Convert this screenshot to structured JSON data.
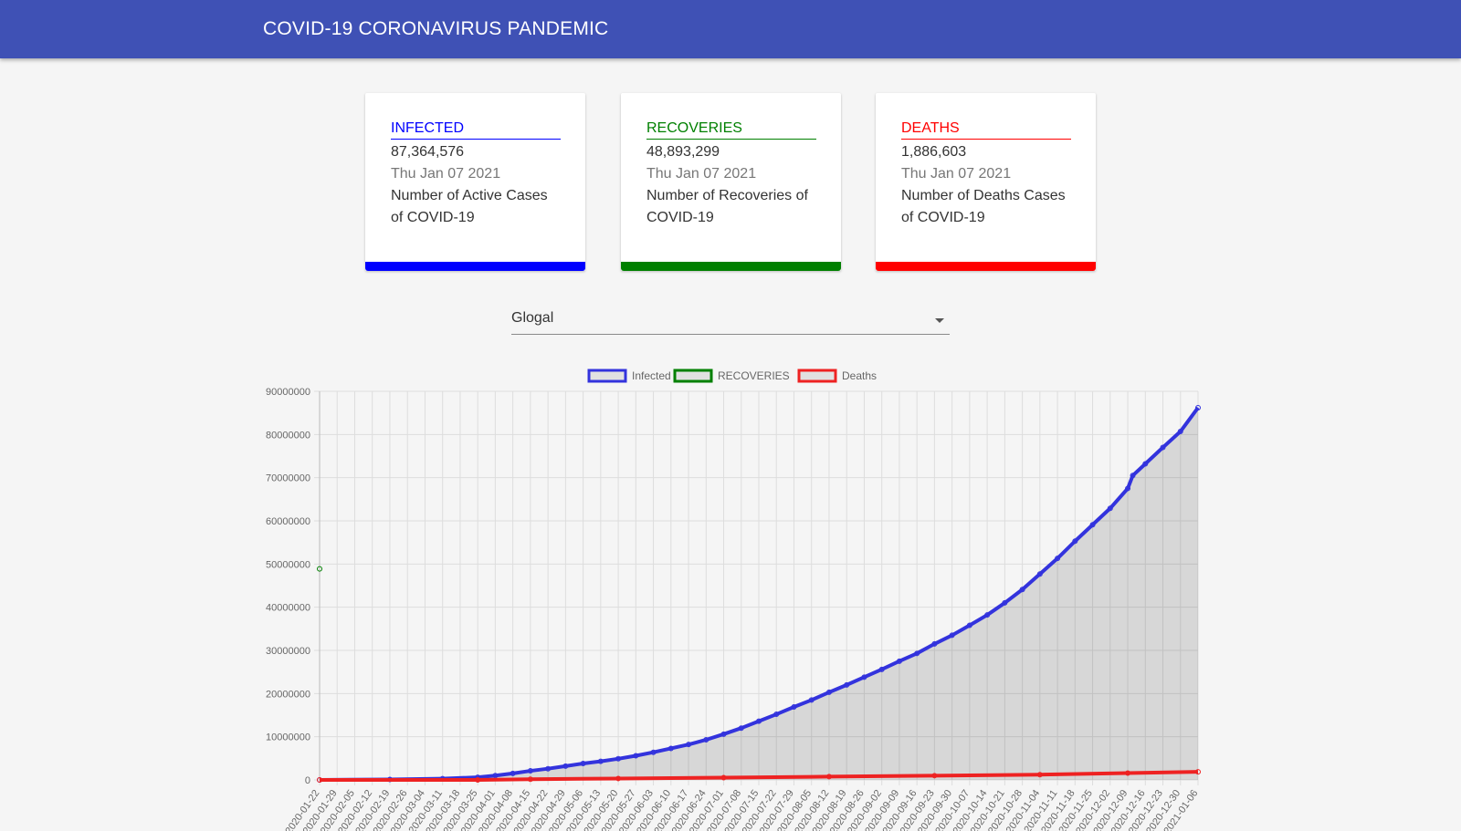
{
  "header": {
    "title": "COVID-19 CORONAVIRUS PANDEMIC"
  },
  "cards": [
    {
      "key": "infected",
      "title": "INFECTED",
      "value": "87,364,576",
      "date": "Thu Jan 07 2021",
      "description": "Number of Active Cases of COVID-19",
      "color": "#0000ff"
    },
    {
      "key": "recoveries",
      "title": "RECOVERIES",
      "value": "48,893,299",
      "date": "Thu Jan 07 2021",
      "description": "Number of Recoveries of COVID-19",
      "color": "#008000"
    },
    {
      "key": "deaths",
      "title": "DEATHS",
      "value": "1,886,603",
      "date": "Thu Jan 07 2021",
      "description": "Number of Deaths Cases of COVID-19",
      "color": "#ff0000"
    }
  ],
  "country_select": {
    "selected": "Glogal"
  },
  "chart_data": {
    "type": "line",
    "legend": [
      "Infected",
      "RECOVERIES",
      "Deaths"
    ],
    "legend_position": "top",
    "grid": true,
    "ylim": [
      0,
      90000000
    ],
    "y_ticks": [
      "0",
      "10000000",
      "20000000",
      "30000000",
      "40000000",
      "50000000",
      "60000000",
      "70000000",
      "80000000",
      "90000000"
    ],
    "x_start": "2020-01-22",
    "x_end": "2021-01-06",
    "x_ticks": [
      "2020-01-22",
      "2020-01-29",
      "2020-02-05",
      "2020-02-12",
      "2020-02-19",
      "2020-02-26",
      "2020-03-04",
      "2020-03-11",
      "2020-03-18",
      "2020-03-25",
      "2020-04-01",
      "2020-04-08",
      "2020-04-15",
      "2020-04-22",
      "2020-04-29",
      "2020-05-06",
      "2020-05-13",
      "2020-05-20",
      "2020-05-27",
      "2020-06-03",
      "2020-06-10",
      "2020-06-17",
      "2020-06-24",
      "2020-07-01",
      "2020-07-08",
      "2020-07-15",
      "2020-07-22",
      "2020-07-29",
      "2020-08-05",
      "2020-08-12",
      "2020-08-19",
      "2020-08-26",
      "2020-09-02",
      "2020-09-09",
      "2020-09-16",
      "2020-09-23",
      "2020-09-30",
      "2020-10-07",
      "2020-10-14",
      "2020-10-21",
      "2020-10-28",
      "2020-11-04",
      "2020-11-11",
      "2020-11-18",
      "2020-11-25",
      "2020-12-02",
      "2020-12-09",
      "2020-12-16",
      "2020-12-23",
      "2020-12-30",
      "2021-01-06"
    ],
    "series": [
      {
        "name": "Infected",
        "color": "#3333dd",
        "fill": true,
        "points": [
          [
            "2020-01-22",
            0
          ],
          [
            "2020-02-19",
            100000
          ],
          [
            "2020-03-11",
            300000
          ],
          [
            "2020-03-25",
            600000
          ],
          [
            "2020-04-01",
            1000000
          ],
          [
            "2020-04-08",
            1500000
          ],
          [
            "2020-04-15",
            2100000
          ],
          [
            "2020-04-22",
            2600000
          ],
          [
            "2020-04-29",
            3200000
          ],
          [
            "2020-05-06",
            3800000
          ],
          [
            "2020-05-13",
            4300000
          ],
          [
            "2020-05-20",
            4900000
          ],
          [
            "2020-05-27",
            5600000
          ],
          [
            "2020-06-03",
            6400000
          ],
          [
            "2020-06-10",
            7300000
          ],
          [
            "2020-06-17",
            8200000
          ],
          [
            "2020-06-24",
            9300000
          ],
          [
            "2020-07-01",
            10600000
          ],
          [
            "2020-07-08",
            12000000
          ],
          [
            "2020-07-15",
            13600000
          ],
          [
            "2020-07-22",
            15200000
          ],
          [
            "2020-07-29",
            16900000
          ],
          [
            "2020-08-05",
            18500000
          ],
          [
            "2020-08-12",
            20300000
          ],
          [
            "2020-08-19",
            22000000
          ],
          [
            "2020-08-26",
            23800000
          ],
          [
            "2020-09-02",
            25600000
          ],
          [
            "2020-09-09",
            27500000
          ],
          [
            "2020-09-16",
            29300000
          ],
          [
            "2020-09-23",
            31500000
          ],
          [
            "2020-09-30",
            33500000
          ],
          [
            "2020-10-07",
            35800000
          ],
          [
            "2020-10-14",
            38200000
          ],
          [
            "2020-10-21",
            41000000
          ],
          [
            "2020-10-28",
            44100000
          ],
          [
            "2020-11-04",
            47700000
          ],
          [
            "2020-11-11",
            51300000
          ],
          [
            "2020-11-18",
            55300000
          ],
          [
            "2020-11-25",
            59100000
          ],
          [
            "2020-12-02",
            62900000
          ],
          [
            "2020-12-09",
            67500000
          ],
          [
            "2020-12-11",
            70500000
          ],
          [
            "2020-12-16",
            73200000
          ],
          [
            "2020-12-23",
            77000000
          ],
          [
            "2020-12-30",
            80700000
          ],
          [
            "2021-01-06",
            86200000
          ]
        ]
      },
      {
        "name": "RECOVERIES",
        "color": "#008000",
        "fill": false,
        "points": [
          [
            "2020-01-22",
            48893299
          ]
        ]
      },
      {
        "name": "Deaths",
        "color": "#ee2222",
        "fill": false,
        "points": [
          [
            "2020-01-22",
            0
          ],
          [
            "2020-03-25",
            10000
          ],
          [
            "2020-04-15",
            150000
          ],
          [
            "2020-05-20",
            330000
          ],
          [
            "2020-07-01",
            520000
          ],
          [
            "2020-08-12",
            760000
          ],
          [
            "2020-09-23",
            990000
          ],
          [
            "2020-11-04",
            1220000
          ],
          [
            "2020-12-09",
            1580000
          ],
          [
            "2021-01-06",
            1886603
          ]
        ]
      }
    ]
  }
}
